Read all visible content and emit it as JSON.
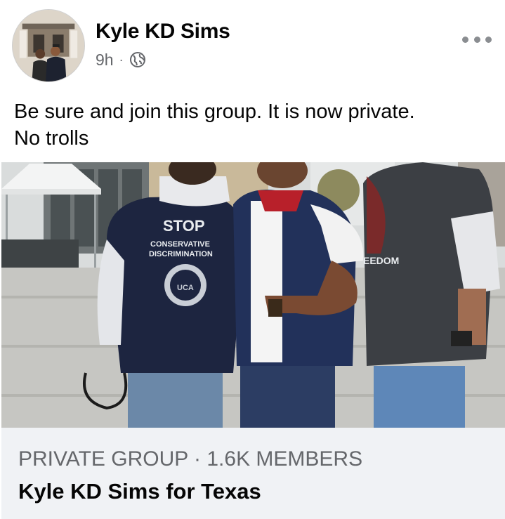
{
  "post": {
    "author_name": "Kyle KD Sims",
    "timestamp": "9h",
    "separator": "·",
    "audience_icon": "globe-icon",
    "more_icon": "more-horizontal-icon",
    "text_line_1": "Be sure and join this group. It is now private.",
    "text_line_2": "No trolls"
  },
  "photo": {
    "shirt_text_1": "STOP",
    "shirt_text_2": "CONSERVATIVE",
    "shirt_text_3": "DISCRIMINATION",
    "shirt_logo_text": "UCA",
    "shirt_text_right": "EEDOM"
  },
  "shared_group": {
    "privacy_and_members": "PRIVATE GROUP · 1.6K MEMBERS",
    "name": "Kyle KD Sims for Texas"
  },
  "colors": {
    "name_text": "#050505",
    "secondary_text": "#65676b",
    "card_footer_bg": "#f0f2f5",
    "icon_gray": "#8a8d91"
  }
}
